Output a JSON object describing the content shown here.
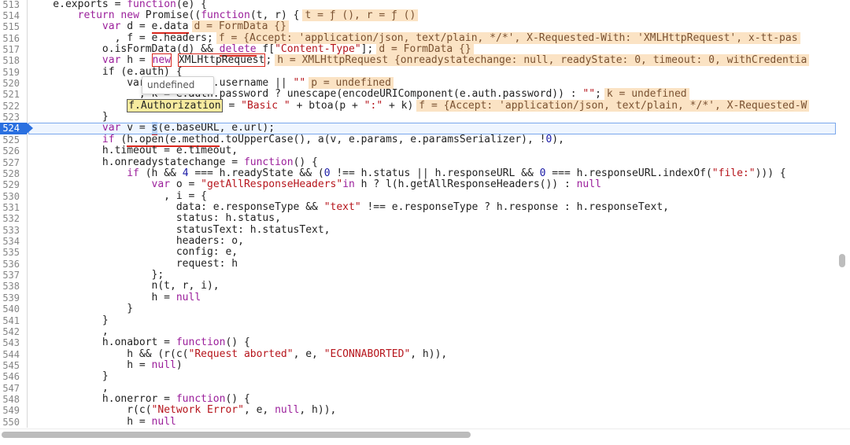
{
  "gutter": [
    "513",
    "514",
    "515",
    "516",
    "517",
    "518",
    "519",
    "520",
    "521",
    "522",
    "523",
    "524",
    "525",
    "526",
    "527",
    "528",
    "529",
    "530",
    "531",
    "532",
    "533",
    "534",
    "535",
    "536",
    "537",
    "538",
    "539",
    "540",
    "541",
    "542",
    "543",
    "544",
    "545",
    "546",
    "547",
    "548",
    "549",
    "550"
  ],
  "current_line": "524",
  "tooltip": "undefined",
  "hints": {
    "l514": "t = ƒ (), r = ƒ ()",
    "l515": "d = FormData {}",
    "l516": "f = {Accept: 'application/json, text/plain, */*', X-Requested-With: 'XMLHttpRequest', x-tt-pas",
    "l517": "d = FormData {}",
    "l518": "h = XMLHttpRequest {onreadystatechange: null, readyState: 0, timeout: 0, withCredentia",
    "l520": "p = undefined",
    "l521": "k = undefined",
    "l522": "f = {Accept: 'application/json, text/plain, */*', X-Requested-W"
  },
  "code": {
    "l513": {
      "a": "    e.exports = ",
      "kw1": "function",
      "b": "(e) {"
    },
    "l514": {
      "ind": "        ",
      "kw1": "return new",
      "a": " Promise((",
      "kw2": "function",
      "b": "(t, r) {"
    },
    "l515": {
      "ind": "            ",
      "kw1": "var",
      "a": " d = ",
      "u": "e.data"
    },
    "l516": {
      "a": "              , f = e.headers;"
    },
    "l517": {
      "a": "            o.isFormData(d) && ",
      "kw1": "delete",
      "b": " f[",
      "s": "\"Content-Type\"",
      "c": "];"
    },
    "l518": {
      "ind": "            ",
      "kw1": "var",
      "a": " h = ",
      "kw2": "new",
      "sp": " ",
      "b": "XMLHttpRequest",
      "c": ";"
    },
    "l519": {
      "a": "            if (e.auth) {"
    },
    "l520": {
      "a": "                var p = e.auth.username || ",
      "s": "\"\""
    },
    "l521": {
      "a": "                  , k = e.auth.password ? unescape(encodeURIComponent(e.auth.password)) : ",
      "s": "\"\"",
      "b": ";"
    },
    "l522": {
      "ind": "                ",
      "a": "f.Authorization",
      "b": " = ",
      "s1": "\"Basic \"",
      "c": " + btoa(p + ",
      "s2": "\":\"",
      "d": " + k)"
    },
    "l523": {
      "a": "            }"
    },
    "l524": {
      "ind": "            ",
      "kw1": "var",
      "a": " v = ",
      "sel": "s",
      "b": "(e.baseURL, e.url);"
    },
    "l525": {
      "ind": "            ",
      "kw1": "if",
      "a": " (",
      "u": "h.open(e.method",
      "b": ".toUpperCase(), a(v, e.params, e.paramsSerializer), !",
      "n": "0",
      "c": "),"
    },
    "l526": {
      "a": "            h.timeout = e.timeout,"
    },
    "l527": {
      "a": "            h.onreadystatechange = ",
      "kw1": "function",
      "b": "() {"
    },
    "l528": {
      "ind": "                ",
      "kw1": "if",
      "a": " (h && ",
      "n1": "4",
      "b": " === h.readyState && (",
      "n2": "0",
      "c": " !== h.status || h.responseURL && ",
      "n3": "0",
      "d": " === h.responseURL.indexOf(",
      "s": "\"file:\"",
      "e": "))) {"
    },
    "l529": {
      "ind": "                    ",
      "kw1": "var",
      "a": " o = ",
      "s": "\"getAllResponseHeaders\"",
      "kw2": "in",
      "b": " h ? l(h.getAllResponseHeaders()) : ",
      "kw3": "null"
    },
    "l530": {
      "a": "                      , i = {"
    },
    "l531": {
      "a": "                        data: e.responseType && ",
      "s": "\"text\"",
      "b": " !== e.responseType ? h.response : h.responseText,"
    },
    "l532": {
      "a": "                        status: h.status,"
    },
    "l533": {
      "a": "                        statusText: h.statusText,"
    },
    "l534": {
      "a": "                        headers: o,"
    },
    "l535": {
      "a": "                        config: e,"
    },
    "l536": {
      "a": "                        request: h"
    },
    "l537": {
      "a": "                    };"
    },
    "l538": {
      "a": "                    n(t, r, i),"
    },
    "l539": {
      "a": "                    h = ",
      "kw1": "null"
    },
    "l540": {
      "a": "                }"
    },
    "l541": {
      "a": "            }"
    },
    "l542": {
      "a": "            ,"
    },
    "l543": {
      "a": "            h.onabort = ",
      "kw1": "function",
      "b": "() {"
    },
    "l544": {
      "a": "                h && (r(c(",
      "s1": "\"Request aborted\"",
      "b": ", e, ",
      "s2": "\"ECONNABORTED\"",
      "c": ", h)),"
    },
    "l545": {
      "a": "                h = ",
      "kw1": "null",
      "b": ")"
    },
    "l546": {
      "a": "            }"
    },
    "l547": {
      "a": "            ,"
    },
    "l548": {
      "a": "            h.onerror = ",
      "kw1": "function",
      "b": "() {"
    },
    "l549": {
      "a": "                r(c(",
      "s": "\"Network Error\"",
      "b": ", e, ",
      "kw1": "null",
      "c": ", h)),"
    },
    "l550": {
      "a": "                h = ",
      "kw1": "null"
    }
  }
}
